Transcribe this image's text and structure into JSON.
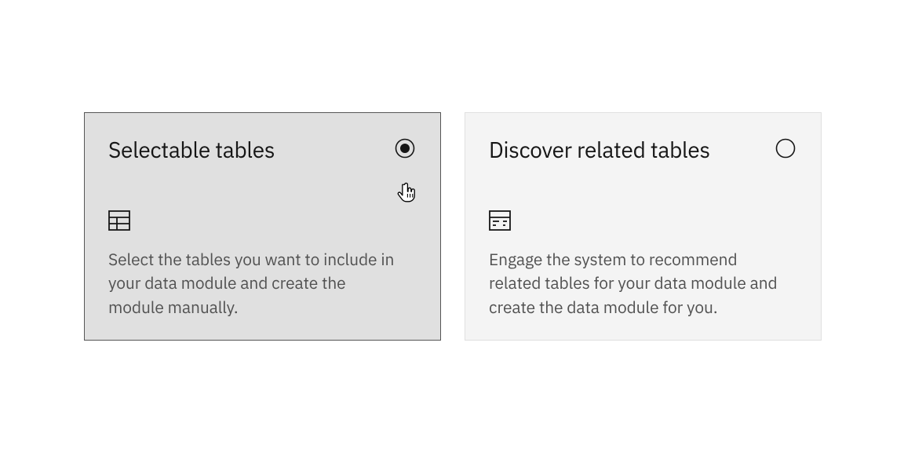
{
  "options": {
    "selectable": {
      "title": "Selectable tables",
      "description": "Select the tables you want to include in your data module and create the module manually.",
      "selected": true
    },
    "discover": {
      "title": "Discover related tables",
      "description": "Engage the system to recommend related tables for your data module and create the data module for you.",
      "selected": false
    }
  }
}
